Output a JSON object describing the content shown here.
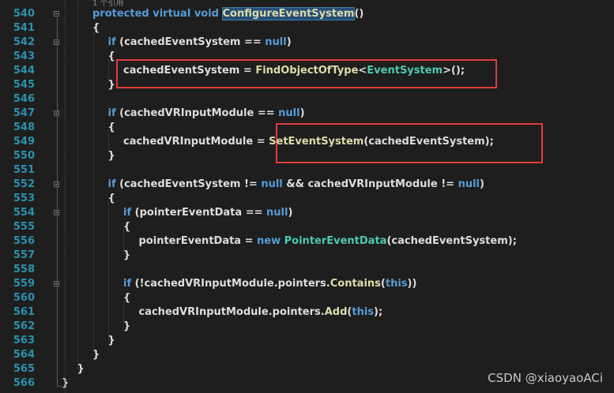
{
  "codelens": "1 个引用",
  "watermark": "CSDN @xiaoyaoACi",
  "lines": [
    {
      "num": "540",
      "indent": 0,
      "segs": [
        [
          "kw",
          "protected virtual void "
        ],
        [
          "hl",
          "ConfigureEventSystem"
        ],
        [
          "pl",
          "()"
        ]
      ]
    },
    {
      "num": "541",
      "indent": 0,
      "segs": [
        [
          "pl",
          "{"
        ]
      ]
    },
    {
      "num": "542",
      "indent": 1,
      "segs": [
        [
          "kw",
          "if"
        ],
        [
          "pl",
          " (cachedEventSystem == "
        ],
        [
          "kw",
          "null"
        ],
        [
          "pl",
          ")"
        ]
      ]
    },
    {
      "num": "543",
      "indent": 1,
      "segs": [
        [
          "pl",
          "{"
        ]
      ]
    },
    {
      "num": "544",
      "indent": 2,
      "segs": [
        [
          "pl",
          "cachedEventSystem = "
        ],
        [
          "fn",
          "FindObjectOfType"
        ],
        [
          "pl",
          "<"
        ],
        [
          "ty",
          "EventSystem"
        ],
        [
          "pl",
          ">();"
        ]
      ]
    },
    {
      "num": "545",
      "indent": 1,
      "segs": [
        [
          "pl",
          "}"
        ]
      ]
    },
    {
      "num": "546",
      "indent": 0,
      "segs": []
    },
    {
      "num": "547",
      "indent": 1,
      "segs": [
        [
          "kw",
          "if"
        ],
        [
          "pl",
          " (cachedVRInputModule == "
        ],
        [
          "kw",
          "null"
        ],
        [
          "pl",
          ")"
        ]
      ]
    },
    {
      "num": "548",
      "indent": 1,
      "segs": [
        [
          "pl",
          "{"
        ]
      ]
    },
    {
      "num": "549",
      "indent": 2,
      "segs": [
        [
          "pl",
          "cachedVRInputModule = "
        ],
        [
          "fn",
          "SetEventSystem"
        ],
        [
          "pl",
          "(cachedEventSystem);"
        ]
      ]
    },
    {
      "num": "550",
      "indent": 1,
      "segs": [
        [
          "pl",
          "}"
        ]
      ]
    },
    {
      "num": "551",
      "indent": 0,
      "segs": []
    },
    {
      "num": "552",
      "indent": 1,
      "segs": [
        [
          "kw",
          "if"
        ],
        [
          "pl",
          " (cachedEventSystem != "
        ],
        [
          "kw",
          "null"
        ],
        [
          "pl",
          " && cachedVRInputModule != "
        ],
        [
          "kw",
          "null"
        ],
        [
          "pl",
          ")"
        ]
      ]
    },
    {
      "num": "553",
      "indent": 1,
      "segs": [
        [
          "pl",
          "{"
        ]
      ]
    },
    {
      "num": "554",
      "indent": 2,
      "segs": [
        [
          "kw",
          "if"
        ],
        [
          "pl",
          " (pointerEventData == "
        ],
        [
          "kw",
          "null"
        ],
        [
          "pl",
          ")"
        ]
      ]
    },
    {
      "num": "555",
      "indent": 2,
      "segs": [
        [
          "pl",
          "{"
        ]
      ]
    },
    {
      "num": "556",
      "indent": 3,
      "segs": [
        [
          "pl",
          "pointerEventData = "
        ],
        [
          "kw",
          "new "
        ],
        [
          "ty",
          "PointerEventData"
        ],
        [
          "pl",
          "(cachedEventSystem);"
        ]
      ]
    },
    {
      "num": "557",
      "indent": 2,
      "segs": [
        [
          "pl",
          "}"
        ]
      ]
    },
    {
      "num": "558",
      "indent": 0,
      "segs": []
    },
    {
      "num": "559",
      "indent": 2,
      "segs": [
        [
          "kw",
          "if"
        ],
        [
          "pl",
          " (!cachedVRInputModule.pointers."
        ],
        [
          "fn",
          "Contains"
        ],
        [
          "pl",
          "("
        ],
        [
          "kw",
          "this"
        ],
        [
          "pl",
          "))"
        ]
      ]
    },
    {
      "num": "560",
      "indent": 2,
      "segs": [
        [
          "pl",
          "{"
        ]
      ]
    },
    {
      "num": "561",
      "indent": 3,
      "segs": [
        [
          "pl",
          "cachedVRInputModule.pointers."
        ],
        [
          "fn",
          "Add"
        ],
        [
          "pl",
          "("
        ],
        [
          "kw",
          "this"
        ],
        [
          "pl",
          ");"
        ]
      ]
    },
    {
      "num": "562",
      "indent": 2,
      "segs": [
        [
          "pl",
          "}"
        ]
      ]
    },
    {
      "num": "563",
      "indent": 1,
      "segs": [
        [
          "pl",
          "}"
        ]
      ]
    },
    {
      "num": "564",
      "indent": 0,
      "segs": [
        [
          "pl",
          "}"
        ]
      ]
    },
    {
      "num": "565",
      "indent": -1,
      "segs": [
        [
          "pl",
          "}"
        ]
      ]
    },
    {
      "num": "566",
      "indent": -2,
      "segs": [
        [
          "pl",
          "}"
        ]
      ]
    }
  ]
}
